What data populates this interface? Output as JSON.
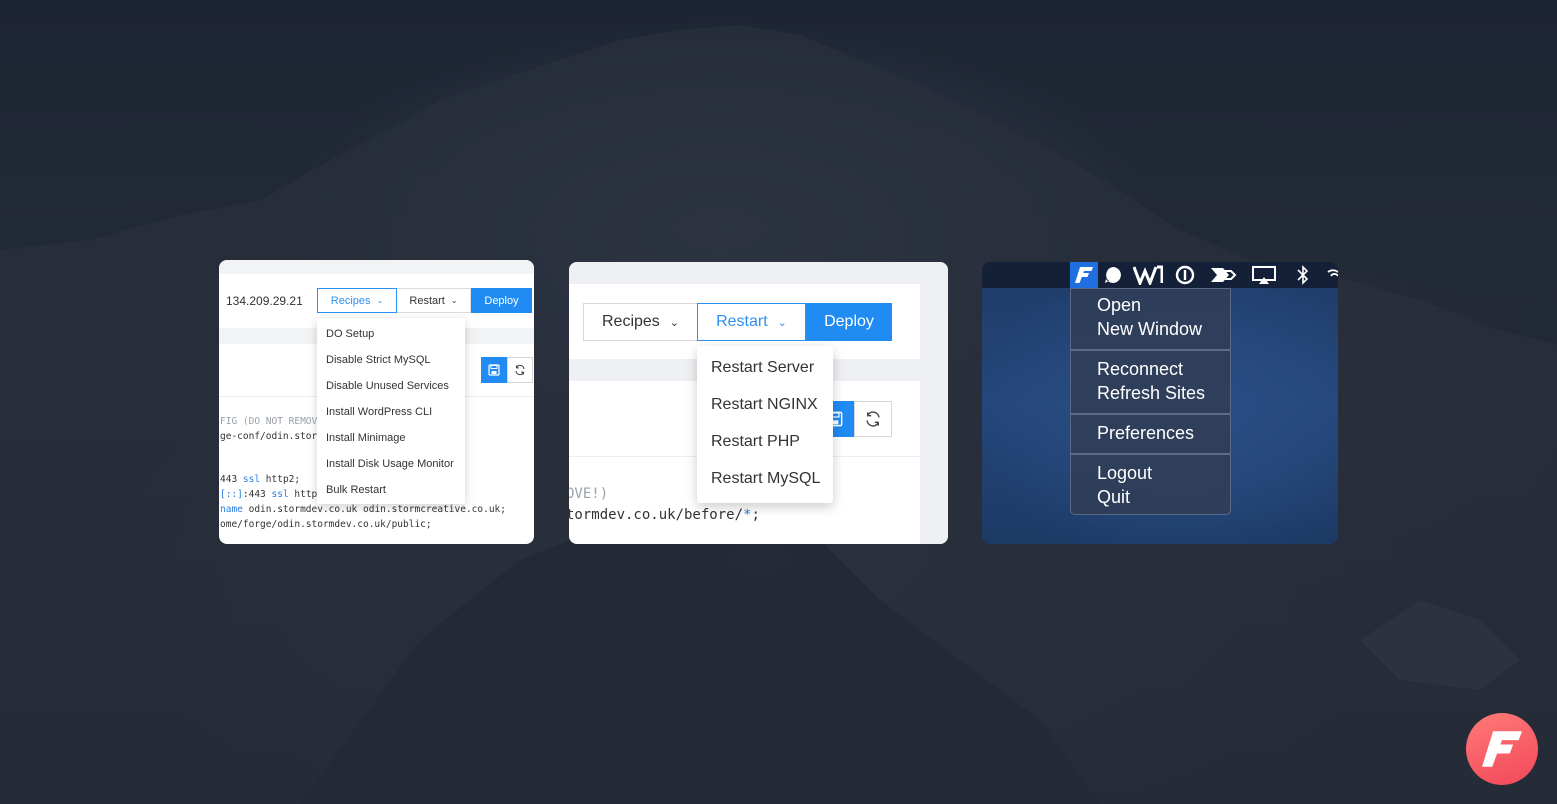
{
  "card1": {
    "ip": "134.209.29.21",
    "recipes_label": "Recipes",
    "restart_label": "Restart",
    "deploy_label": "Deploy",
    "menu_items": [
      "DO Setup",
      "Disable Strict MySQL",
      "Disable Unused Services",
      "Install WordPress CLI",
      "Install Minimage",
      "Install Disk Usage Monitor",
      "Bulk Restart"
    ],
    "code": {
      "line1": "FIG (DO NOT REMOV",
      "line2": "ge-conf/odin.stor",
      "line3_a": "443 ",
      "line3_kw": "ssl",
      "line3_b": " http2;",
      "line4_kw": "[::]",
      "line4_a": ":443 ",
      "line4_kw2": "ssl",
      "line4_b": " http",
      "line5_kw": "name",
      "line5_a": " odin.stormdev.co.uk odin.stormcreative.co.uk;",
      "line6": "ome/forge/odin.stormdev.co.uk/public;"
    }
  },
  "card2": {
    "recipes_label": "Recipes",
    "restart_label": "Restart",
    "deploy_label": "Deploy",
    "menu_items": [
      "Restart Server",
      "Restart NGINX",
      "Restart PHP",
      "Restart MySQL"
    ],
    "code": {
      "line1": "OVE!)",
      "line2_a": "tormdev.co.uk/before/",
      "line2_kw": "*",
      "line2_b": ";"
    }
  },
  "card3": {
    "menu_groups": [
      [
        "Open",
        "New Window"
      ],
      [
        "Reconnect",
        "Refresh Sites"
      ],
      [
        "Preferences"
      ],
      [
        "Logout",
        "Quit"
      ]
    ]
  },
  "colors": {
    "accent": "#1f8bf3",
    "badge": "#f2485a"
  }
}
